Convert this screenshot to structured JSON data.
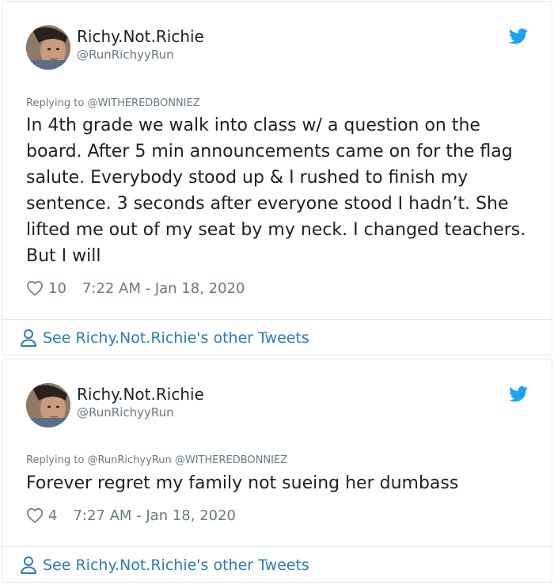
{
  "colors": {
    "link": "#2b7bb9",
    "muted": "#697882",
    "text": "#1c2022",
    "twitter_blue": "#1da1f2"
  },
  "icons": {
    "brand": "twitter-bird-icon",
    "like": "heart-icon",
    "profile": "person-icon"
  },
  "tweets": [
    {
      "display_name": "Richy.Not.Richie",
      "handle": "@RunRichyyRun",
      "reply_prefix": "Replying to ",
      "reply_to": "@WITHEREDBONNIEZ",
      "text": "In 4th grade we walk into class w/ a question on the board. After 5 min announcements came on for the flag salute. Everybody stood up & I rushed to finish my sentence. 3 seconds after everyone stood I hadn’t. She lifted me out of my seat by my neck. I changed teachers. But I will",
      "likes": "10",
      "timestamp": "7:22 AM - Jan 18, 2020",
      "footer_link": "See Richy.Not.Richie's other Tweets"
    },
    {
      "display_name": "Richy.Not.Richie",
      "handle": "@RunRichyyRun",
      "reply_prefix": "Replying to ",
      "reply_to": "@RunRichyyRun @WITHEREDBONNIEZ",
      "text": "Forever regret my family not sueing her dumbass",
      "likes": "4",
      "timestamp": "7:27 AM - Jan 18, 2020",
      "footer_link": "See Richy.Not.Richie's other Tweets"
    }
  ]
}
